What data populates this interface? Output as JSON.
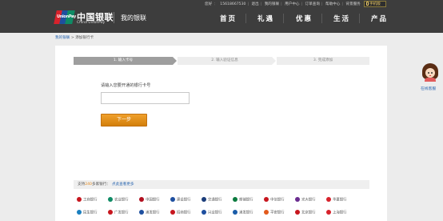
{
  "header": {
    "logo_mark_text": "UnionPay",
    "logo_cn": "中国银联",
    "logo_en": "China UnionPay",
    "section_title": "我的银联",
    "top_links": [
      "您好",
      "15618667530",
      "退出",
      "我的银联",
      "用户中心",
      "订单查询",
      "帮助中心",
      "背景服务"
    ],
    "mobile_label": "手机版",
    "nav": [
      "首页",
      "礼遇",
      "优惠",
      "生活",
      "产品"
    ]
  },
  "breadcrumb": {
    "home": "我的银联",
    "separator": ">",
    "current": "添加银行卡"
  },
  "steps": [
    {
      "label": "1. 输入卡号",
      "active": true
    },
    {
      "label": "2. 输入验证信息",
      "active": false
    },
    {
      "label": "3. 完成添加",
      "active": false
    }
  ],
  "form": {
    "card_label": "请输入您要开通的银行卡号",
    "card_value": "",
    "card_placeholder": "",
    "next_button": "下一步"
  },
  "support": {
    "prefix": "支持",
    "count": "240",
    "suffix": "多家银行：",
    "more_link": "点此查看更多"
  },
  "banks": [
    {
      "name": "工商银行",
      "color": "#c7161e"
    },
    {
      "name": "农业银行",
      "color": "#0f8b65"
    },
    {
      "name": "中国银行",
      "color": "#b10f1f"
    },
    {
      "name": "建设银行",
      "color": "#1e4f9f"
    },
    {
      "name": "交通银行",
      "color": "#1b3d7a"
    },
    {
      "name": "邮储银行",
      "color": "#0a7a3e"
    },
    {
      "name": "中信银行",
      "color": "#c7161e"
    },
    {
      "name": "光大银行",
      "color": "#6a2c8f"
    },
    {
      "name": "华夏银行",
      "color": "#d7222b"
    },
    {
      "name": "民生银行",
      "color": "#1a7fbf"
    },
    {
      "name": "广发银行",
      "color": "#c7161e"
    },
    {
      "name": "浦发银行",
      "color": "#1e4f9f"
    },
    {
      "name": "招商银行",
      "color": "#c7161e"
    },
    {
      "name": "兴业银行",
      "color": "#1e4f9f"
    },
    {
      "name": "浦发银行",
      "color": "#1a5ca8"
    },
    {
      "name": "平安银行",
      "color": "#e25a1c"
    },
    {
      "name": "北京银行",
      "color": "#c7161e"
    },
    {
      "name": "上海银行",
      "color": "#d7222b"
    }
  ],
  "service": {
    "label": "在线客服"
  }
}
